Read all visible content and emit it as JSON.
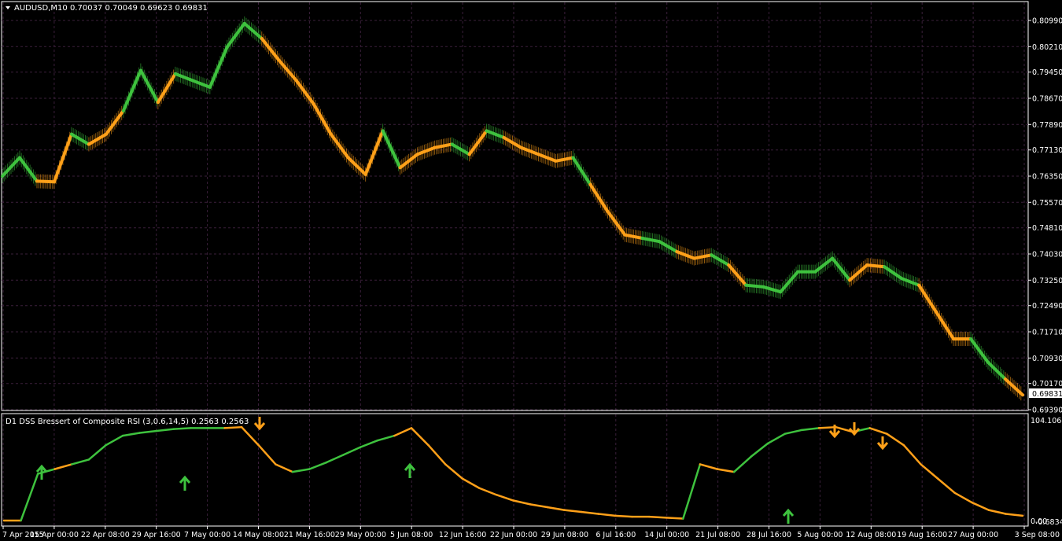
{
  "main": {
    "header": "AUDUSD,M10  0.70037 0.70049 0.69623 0.69831",
    "current_price": "0.69831",
    "y_ticks": [
      "0.80990",
      "0.80210",
      "0.79450",
      "0.78670",
      "0.77890",
      "0.77130",
      "0.76350",
      "0.75570",
      "0.74810",
      "0.74030",
      "0.73250",
      "0.72490",
      "0.71710",
      "0.70930",
      "0.70170",
      "0.69390"
    ]
  },
  "sub": {
    "header": "D1 DSS Bressert of Composite RSI (3,0.6,14,5) 0.2563 0.2563",
    "y_top": "104.1068",
    "y_bottom_a": "0.00",
    "y_bottom_b": "-0.6834"
  },
  "x_labels": [
    "7 Apr 2015",
    "15 Apr 00:00",
    "22 Apr 08:00",
    "29 Apr 16:00",
    "7 May 00:00",
    "14 May 08:00",
    "21 May 16:00",
    "29 May 00:00",
    "5 Jun 08:00",
    "12 Jun 16:00",
    "22 Jun 00:00",
    "29 Jun 08:00",
    "6 Jul 16:00",
    "14 Jul 00:00",
    "21 Jul 08:00",
    "28 Jul 16:00",
    "5 Aug 00:00",
    "12 Aug 08:00",
    "19 Aug 16:00",
    "27 Aug 00:00",
    "3 Sep 08:00"
  ],
  "colors": {
    "up": "#3ec23e",
    "down": "#ffa019",
    "grid": "#3a1f3a",
    "axis": "#ffffff"
  },
  "chart_data": [
    {
      "type": "line",
      "title": "AUDUSD,M10",
      "x": [
        "7 Apr",
        "10 Apr",
        "13 Apr",
        "15 Apr",
        "17 Apr",
        "19 Apr",
        "21 Apr",
        "23 Apr",
        "26 Apr",
        "29 Apr",
        "1 May",
        "3 May",
        "6 May",
        "9 May",
        "12 May",
        "14 May",
        "16 May",
        "19 May",
        "21 May",
        "24 May",
        "27 May",
        "29 May",
        "1 Jun",
        "3 Jun",
        "5 Jun",
        "8 Jun",
        "11 Jun",
        "13 Jun",
        "15 Jun",
        "17 Jun",
        "20 Jun",
        "23 Jun",
        "26 Jun",
        "29 Jun",
        "1 Jul",
        "3 Jul",
        "6 Jul",
        "9 Jul",
        "12 Jul",
        "14 Jul",
        "16 Jul",
        "19 Jul",
        "22 Jul",
        "25 Jul",
        "28 Jul",
        "30 Jul",
        "2 Aug",
        "5 Aug",
        "8 Aug",
        "10 Aug",
        "12 Aug",
        "15 Aug",
        "17 Aug",
        "19 Aug",
        "21 Aug",
        "24 Aug",
        "27 Aug",
        "29 Aug",
        "1 Sep",
        "3 Sep"
      ],
      "series": [
        {
          "values": [
            0.7635,
            0.769,
            0.762,
            0.7618,
            0.776,
            0.773,
            0.776,
            0.783,
            0.795,
            0.7855,
            0.794,
            0.792,
            0.79,
            0.802,
            0.809,
            0.8045,
            0.798,
            0.792,
            0.785,
            0.776,
            0.769,
            0.764,
            0.777,
            0.766,
            0.77,
            0.772,
            0.773,
            0.77,
            0.777,
            0.775,
            0.772,
            0.77,
            0.768,
            0.769,
            0.761,
            0.753,
            0.746,
            0.745,
            0.744,
            0.741,
            0.739,
            0.74,
            0.737,
            0.731,
            0.7305,
            0.729,
            0.735,
            0.735,
            0.739,
            0.7325,
            0.737,
            0.7365,
            0.733,
            0.731,
            0.723,
            0.715,
            0.715,
            0.708,
            0.703,
            0.6983
          ],
          "color_states": [
            "up",
            "up",
            "down",
            "down",
            "up",
            "down",
            "down",
            "up",
            "up",
            "down",
            "up",
            "up",
            "up",
            "up",
            "up",
            "down",
            "down",
            "down",
            "down",
            "down",
            "down",
            "down",
            "up",
            "down",
            "down",
            "down",
            "up",
            "down",
            "up",
            "down",
            "down",
            "down",
            "down",
            "up",
            "down",
            "down",
            "down",
            "up",
            "up",
            "down",
            "down",
            "up",
            "down",
            "up",
            "up",
            "up",
            "up",
            "up",
            "up",
            "down",
            "down",
            "up",
            "up",
            "down",
            "down",
            "down",
            "up",
            "up",
            "down",
            "down"
          ]
        }
      ],
      "ylim": [
        0.6939,
        0.8099
      ]
    },
    {
      "type": "line",
      "title": "D1 DSS Bressert of Composite RSI (3,0.6,14,5)",
      "x_index": [
        0,
        1,
        2,
        3,
        4,
        5,
        6,
        7,
        8,
        9,
        10,
        11,
        12,
        13,
        14,
        15,
        16,
        17,
        18,
        19,
        20,
        21,
        22,
        23,
        24,
        25,
        26,
        27,
        28,
        29,
        30,
        31,
        32,
        33,
        34,
        35,
        36,
        37,
        38,
        39,
        40,
        41,
        42,
        43,
        44,
        45,
        46,
        47,
        48,
        49,
        50,
        51,
        52,
        53,
        54,
        55,
        56,
        57,
        58,
        59,
        60
      ],
      "series": [
        {
          "values": [
            1,
            1,
            50,
            55,
            60,
            65,
            80,
            90,
            93,
            95,
            97,
            98,
            98,
            98,
            99,
            80,
            60,
            52,
            55,
            62,
            70,
            78,
            85,
            90,
            98,
            80,
            60,
            45,
            35,
            28,
            22,
            18,
            15,
            12,
            10,
            8,
            6,
            5,
            5,
            4,
            3,
            60,
            55,
            52,
            68,
            82,
            92,
            96,
            98,
            99,
            94,
            98,
            92,
            80,
            60,
            45,
            30,
            20,
            12,
            8,
            6
          ],
          "color_states": [
            "down",
            "down",
            "up",
            "up",
            "down",
            "up",
            "up",
            "up",
            "up",
            "up",
            "up",
            "up",
            "up",
            "up",
            "down",
            "down",
            "down",
            "down",
            "up",
            "up",
            "up",
            "up",
            "up",
            "up",
            "down",
            "down",
            "down",
            "down",
            "down",
            "down",
            "down",
            "down",
            "down",
            "down",
            "down",
            "down",
            "down",
            "down",
            "down",
            "down",
            "down",
            "up",
            "down",
            "down",
            "up",
            "up",
            "up",
            "up",
            "up",
            "down",
            "down",
            "up",
            "down",
            "down",
            "down",
            "down",
            "down",
            "down",
            "down",
            "down",
            "down"
          ]
        }
      ],
      "arrows_up_at": [
        "15 Apr",
        "29 Apr",
        "5 Jun",
        "28 Jul"
      ],
      "arrows_down_at": [
        "14 May",
        "5 Aug",
        "12 Aug",
        "12 Aug",
        "14 Aug"
      ],
      "ylim": [
        -0.6834,
        104.1068
      ]
    }
  ]
}
